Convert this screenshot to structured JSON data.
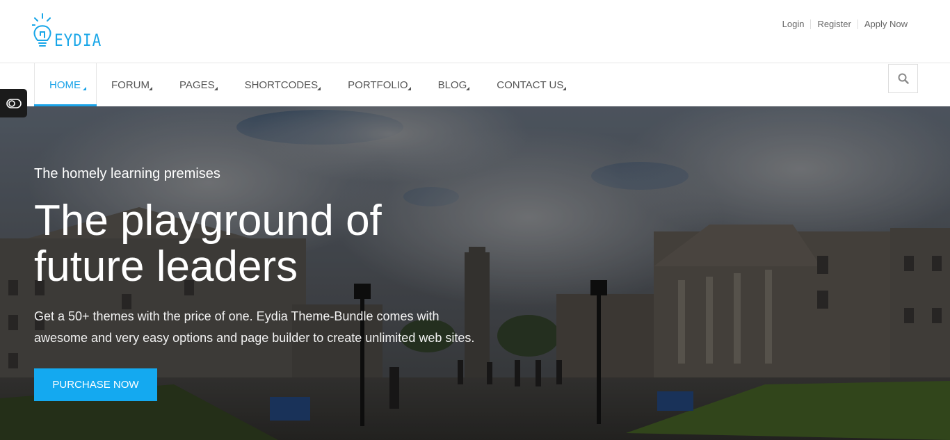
{
  "brand": {
    "logo_text": "EYDIA",
    "accent": "#1aa3e8"
  },
  "auth_links": [
    {
      "label": "Login"
    },
    {
      "label": "Register"
    },
    {
      "label": "Apply Now"
    }
  ],
  "nav": {
    "items": [
      {
        "label": "HOME",
        "active": true
      },
      {
        "label": "FORUM"
      },
      {
        "label": "PAGES"
      },
      {
        "label": "SHORTCODES"
      },
      {
        "label": "PORTFOLIO"
      },
      {
        "label": "BLOG"
      },
      {
        "label": "CONTACT US"
      }
    ],
    "search_icon": "search-icon"
  },
  "side_toggle_icon": "toggle-icon",
  "hero": {
    "eyebrow": "The homely learning premises",
    "headline_line1": "The playground of",
    "headline_line2": "future leaders",
    "subtext_line1": "Get a 50+ themes with the price of one. Eydia Theme-Bundle comes with",
    "subtext_line2": "awesome and very easy options and page builder to create unlimited web sites.",
    "cta_label": "PURCHASE NOW",
    "cta_color": "#14a9f0"
  }
}
